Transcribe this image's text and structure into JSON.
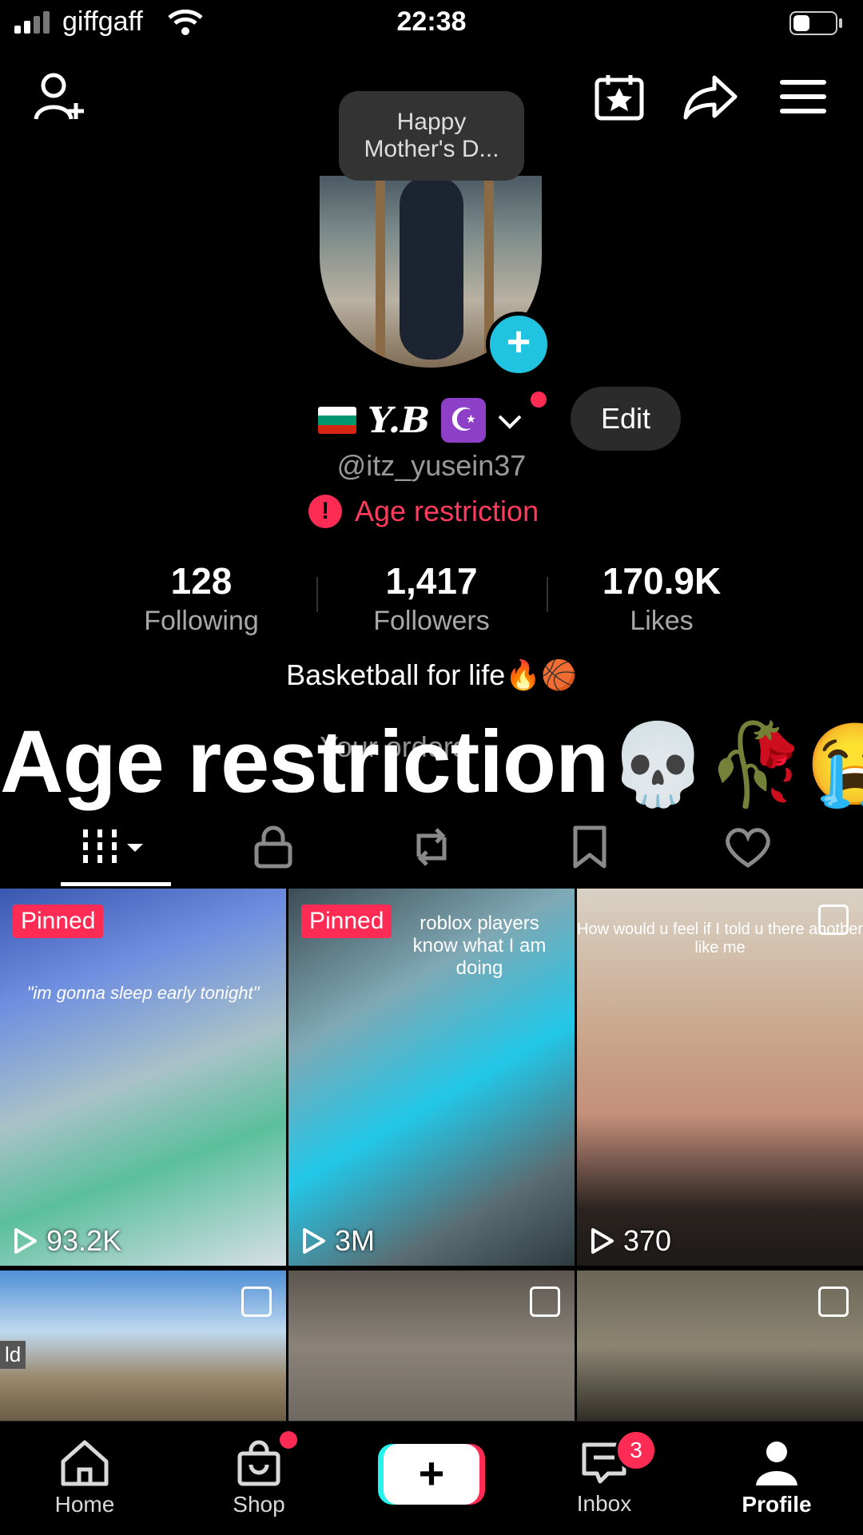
{
  "status_bar": {
    "carrier": "giffgaff",
    "time": "22:38"
  },
  "event_tooltip": {
    "line1": "Happy",
    "line2": "Mother's D..."
  },
  "profile": {
    "display_name": "Y.B",
    "moon_emoji": "☪️",
    "username": "@itz_yusein37",
    "edit_label": "Edit",
    "warning": "Age restriction",
    "bio": "Basketball for life🔥🏀",
    "orders_label": "Your orders"
  },
  "stats": {
    "following": {
      "value": "128",
      "label": "Following"
    },
    "followers": {
      "value": "1,417",
      "label": "Followers"
    },
    "likes": {
      "value": "170.9K",
      "label": "Likes"
    }
  },
  "overlay_caption": {
    "text": "Age restriction",
    "emojis": "💀🥀😭"
  },
  "videos": [
    {
      "pinned": "Pinned",
      "caption": "\"im gonna sleep early tonight\"",
      "views": "93.2K"
    },
    {
      "pinned": "Pinned",
      "caption": "roblox players know what I am doing",
      "views": "3M"
    },
    {
      "caption": "How would u feel if I told u there another like me",
      "views": "370"
    },
    {
      "caption": "ld"
    },
    {
      "caption": ""
    },
    {
      "caption": ""
    }
  ],
  "bottom_nav": {
    "home": "Home",
    "shop": "Shop",
    "inbox": "Inbox",
    "inbox_badge": "3",
    "profile": "Profile",
    "create": "+"
  },
  "colors": {
    "accent": "#fe2c55",
    "cyan": "#25f4ee",
    "background": "#000000"
  }
}
